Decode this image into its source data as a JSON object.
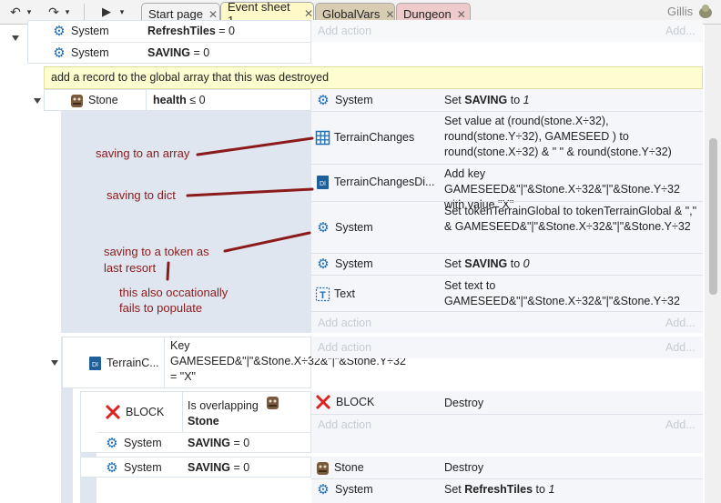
{
  "tabs": [
    {
      "label": "Start page",
      "bg": "#d6d6d6"
    },
    {
      "label": "Event sheet 1",
      "bg": "#fff9c7"
    },
    {
      "label": "GlobalVars",
      "bg": "#d8cdb3"
    },
    {
      "label": "Dungeon",
      "bg": "#efcaca"
    }
  ],
  "user_name": "Gillis",
  "rows": {
    "top1": {
      "object": "System",
      "cond_prefix": "RefreshTiles",
      "cond_suffix": " = 0",
      "add_action": "Add action",
      "add_more": "Add..."
    },
    "top2": {
      "object": "System",
      "cond_prefix": "SAVING",
      "cond_suffix": " = 0"
    },
    "comment": "add a record to the global array that this was destroyed",
    "stone_event": {
      "object": "Stone",
      "cond_prefix": "health",
      "cond_suffix": " ≤ 0"
    },
    "actions": [
      {
        "object": "System",
        "text_a": "Set ",
        "text_b": "SAVING",
        "text_c": " to ",
        "text_d": "1"
      },
      {
        "object": "TerrainChanges",
        "text": "Set value at (round(stone.X÷32), round(stone.Y÷32), GAMESEED ) to round(stone.X÷32) & \" \" & round(stone.Y÷32)"
      },
      {
        "object": "TerrainChangesDi...",
        "text": "Add key GAMESEED&\"|\"&Stone.X÷32&\"|\"&Stone.Y÷32 with value \"X\""
      },
      {
        "object": "System",
        "text": "Set tokenTerrainGlobal to tokenTerrainGlobal & \",\" & GAMESEED&\"|\"&Stone.X÷32&\"|\"&Stone.Y÷32"
      },
      {
        "object": "System",
        "text_a": "Set ",
        "text_b": "SAVING",
        "text_c": " to ",
        "text_d": "0"
      },
      {
        "object": "Text",
        "text": "Set text to GAMESEED&\"|\"&Stone.X÷32&\"|\"&Stone.Y÷32"
      }
    ],
    "add_action_1": "Add action",
    "add_more_1": "Add...",
    "sub1": {
      "object": "TerrainC...",
      "cond": "Key GAMESEED&\"|\"&Stone.X÷32&\"|\"&Stone.Y÷32 = \"X\"",
      "add_action": "Add action",
      "add_more": "Add..."
    },
    "sub2": {
      "object": "BLOCK",
      "cond": "Is overlapping",
      "cond_obj": "Stone",
      "act_object": "BLOCK",
      "act": "Destroy",
      "add_action": "Add action",
      "add_more": "Add..."
    },
    "sub2b": {
      "object": "System",
      "cond_prefix": "SAVING",
      "cond_suffix": " = 0"
    },
    "sub3": {
      "object": "System",
      "cond_prefix": "SAVING",
      "cond_suffix": " = 0",
      "act1_object": "Stone",
      "act1": "Destroy",
      "act2_object": "System",
      "act2_a": "Set ",
      "act2_b": "RefreshTiles",
      "act2_c": " to ",
      "act2_d": "1"
    }
  },
  "annotations": {
    "a1": "saving to an array",
    "a2": "saving to dict",
    "a3_line1": "saving to a token as",
    "a3_line2": "last resort",
    "a4_line1": "this also occationally",
    "a4_line2": "fails to populate"
  },
  "colors": {
    "annotation": "#8b1a1a",
    "accent": "#1f6fb5"
  }
}
